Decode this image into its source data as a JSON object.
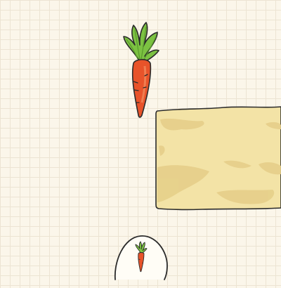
{
  "scene": {
    "background_color": "#fbf6ea",
    "grid_color": "#ece4d3"
  },
  "items": {
    "carrot": {
      "icon": "carrot-icon",
      "body_color": "#e8532a",
      "leaf_color": "#7cc242"
    },
    "ground_block": {
      "icon": "sand-block",
      "fill_color": "#f3e3a6",
      "patch_color": "#e6cf8a"
    }
  },
  "inventory": {
    "slots": [
      {
        "item": "carrot",
        "icon": "carrot-icon"
      }
    ]
  }
}
